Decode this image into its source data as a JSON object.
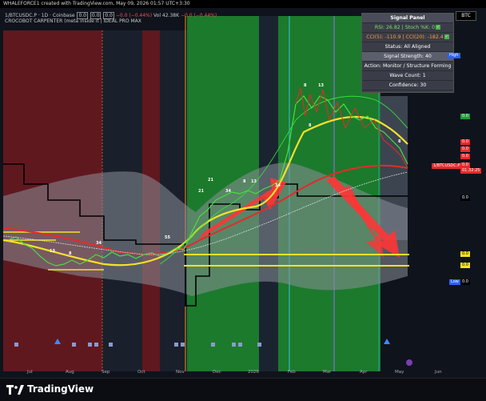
{
  "header": {
    "text": "WHALEFORCE1 created with TradingView.com, May 09, 2026 01:57 UTC+3:30"
  },
  "legend": {
    "symbol": "1/BTCUSDC.P · 1D · Coinbase",
    "v1": "0.0",
    "v2": "0.0",
    "v3": "0.0",
    "change": "−0.0 (−0.44%)",
    "volume": "Vol 42.38K",
    "vol_change": "−0.0 (−0.44%)",
    "indicator": "CROCOBOT CARPENTER (meta inside it | IDEAL PRO MAX"
  },
  "signal_panel": {
    "title": "Signal Panel",
    "rsi_stoch": "RSI: 26.82 | Stoch %K: 0",
    "cci": "CCI(5): -110.9 | CCI(20): -182.4",
    "status": "Status: All Aligned",
    "strength": "Signal Strength: 40",
    "action": "Action: Monitor / Structure Forming",
    "wave": "Wave Count: 1",
    "confidence": "Confidence: 30"
  },
  "symbol_badge": "BTC",
  "price_tags": {
    "high": "High",
    "low": "Low",
    "current_label": "1/BTCUSDC.P",
    "current_value": "0.0",
    "countdown": "01:32:25",
    "zero": "0.0"
  },
  "chart_numbers": [
    "8",
    "13",
    "21",
    "34",
    "55",
    "8",
    "13",
    "21",
    "34",
    "8",
    "13",
    "21",
    "34",
    "8",
    "13",
    "21",
    "8",
    "13"
  ],
  "x_axis": [
    "Jul",
    "Aug",
    "Sep",
    "Oct",
    "Nov",
    "Dec",
    "2026",
    "Feb",
    "Mar",
    "Apr",
    "May",
    "Jun"
  ],
  "footer": {
    "brand": "TradingView"
  },
  "colors": {
    "bg": "#0e1118",
    "green_zone": "#1e7a2c",
    "red_zone": "#7a1a1e",
    "arrow": "#ff3030",
    "yellow": "#f5e12a",
    "red_line": "#e52a2a"
  }
}
